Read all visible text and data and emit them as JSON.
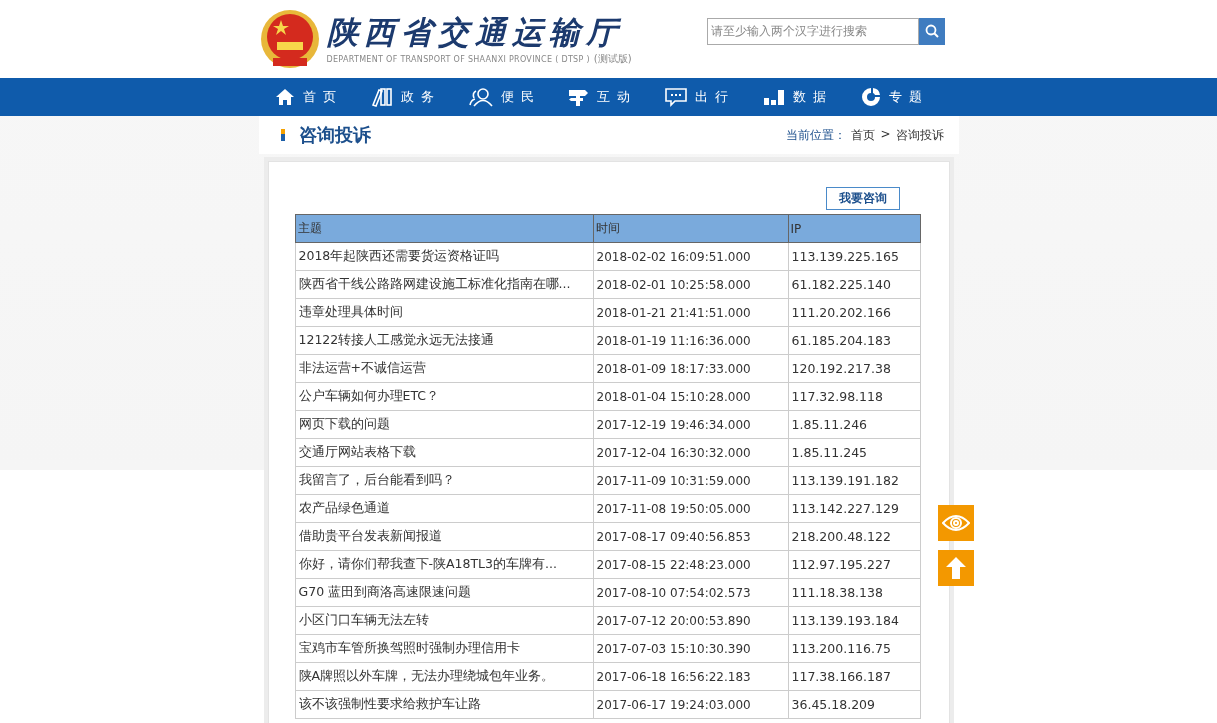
{
  "header": {
    "title": "陕西省交通运输厅",
    "subtitle": "DEPARTMENT OF TRANSPORT OF SHAANXI PROVINCE ( DTSP )",
    "edition": "(测试版)",
    "search": {
      "placeholder": "请至少输入两个汉字进行搜索"
    }
  },
  "nav": [
    {
      "label": "首页"
    },
    {
      "label": "政务"
    },
    {
      "label": "便民"
    },
    {
      "label": "互动"
    },
    {
      "label": "出行"
    },
    {
      "label": "数据"
    },
    {
      "label": "专题"
    }
  ],
  "page_title": "咨询投诉",
  "breadcrumb": {
    "label": "当前位置：",
    "items": [
      "首页",
      "咨询投诉"
    ],
    "separator": ">"
  },
  "ask_button": "我要咨询",
  "table": {
    "columns": [
      "主题",
      "时间",
      "IP"
    ],
    "rows": [
      [
        "2018年起陕西还需要货运资格证吗",
        "2018-02-02 16:09:51.000",
        "113.139.225.165"
      ],
      [
        "陕西省干线公路路网建设施工标准化指南在哪...",
        "2018-02-01 10:25:58.000",
        "61.182.225.140"
      ],
      [
        "违章处理具体时间",
        "2018-01-21 21:41:51.000",
        "111.20.202.166"
      ],
      [
        "12122转接人工感觉永远无法接通",
        "2018-01-19 11:16:36.000",
        "61.185.204.183"
      ],
      [
        "非法运营+不诚信运营",
        "2018-01-09 18:17:33.000",
        "120.192.217.38"
      ],
      [
        "公户车辆如何办理ETC？",
        "2018-01-04 15:10:28.000",
        "117.32.98.118"
      ],
      [
        "网页下载的问题",
        "2017-12-19 19:46:34.000",
        "1.85.11.246"
      ],
      [
        "交通厅网站表格下载",
        "2017-12-04 16:30:32.000",
        "1.85.11.245"
      ],
      [
        "我留言了，后台能看到吗？",
        "2017-11-09 10:31:59.000",
        "113.139.191.182"
      ],
      [
        "农产品绿色通道",
        "2017-11-08 19:50:05.000",
        "113.142.227.129"
      ],
      [
        "借助贵平台发表新闻报道",
        "2017-08-17 09:40:56.853",
        "218.200.48.122"
      ],
      [
        "你好，请你们帮我查下-陕A18TL3的车牌有...",
        "2017-08-15 22:48:23.000",
        "112.97.195.227"
      ],
      [
        "G70 蓝田到商洛高速限速问题",
        "2017-08-10 07:54:02.573",
        "111.18.38.138"
      ],
      [
        "小区门口车辆无法左转",
        "2017-07-12 20:00:53.890",
        "113.139.193.184"
      ],
      [
        "宝鸡市车管所换驾照时强制办理信用卡",
        "2017-07-03 15:10:30.390",
        "113.200.116.75"
      ],
      [
        "陕A牌照以外车牌，无法办理绕城包年业务。",
        "2017-06-18 16:56:22.183",
        "117.38.166.187"
      ],
      [
        "该不该强制性要求给救护车让路",
        "2017-06-17 19:24:03.000",
        "36.45.18.209"
      ]
    ]
  }
}
